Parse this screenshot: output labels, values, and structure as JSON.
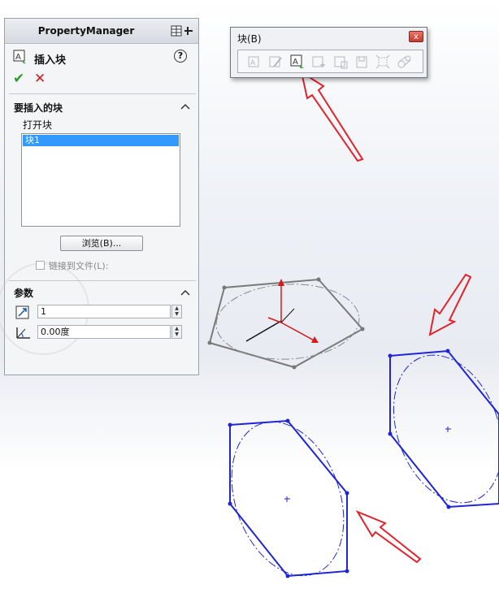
{
  "property_manager": {
    "title": "PropertyManager",
    "command_title": "插入块",
    "help": "?",
    "ok": "✔",
    "cancel": "✕",
    "section_blocks": {
      "title": "要插入的块",
      "open_label": "打开块",
      "items": [
        "块1"
      ],
      "browse_label": "浏览(B)...",
      "link_label": "链接到文件(L):",
      "link_checked": false
    },
    "section_params": {
      "title": "参数",
      "scale_value": "1",
      "angle_value": "0.00度"
    }
  },
  "toolbar": {
    "title": "块(B)",
    "close": "x",
    "buttons": [
      {
        "name": "make-block-icon",
        "enabled": false
      },
      {
        "name": "edit-block-icon",
        "enabled": false
      },
      {
        "name": "insert-block-icon",
        "enabled": true
      },
      {
        "name": "add-remove-icon",
        "enabled": false
      },
      {
        "name": "rebuild-block-icon",
        "enabled": false
      },
      {
        "name": "save-block-icon",
        "enabled": false
      },
      {
        "name": "explode-block-icon",
        "enabled": false
      },
      {
        "name": "belt-chain-icon",
        "enabled": false
      }
    ]
  },
  "colors": {
    "sketch_blue": "#1f25d6",
    "preview_gray": "#808080",
    "arrow_red": "#e3232c",
    "selection_blue": "#3399ff"
  }
}
